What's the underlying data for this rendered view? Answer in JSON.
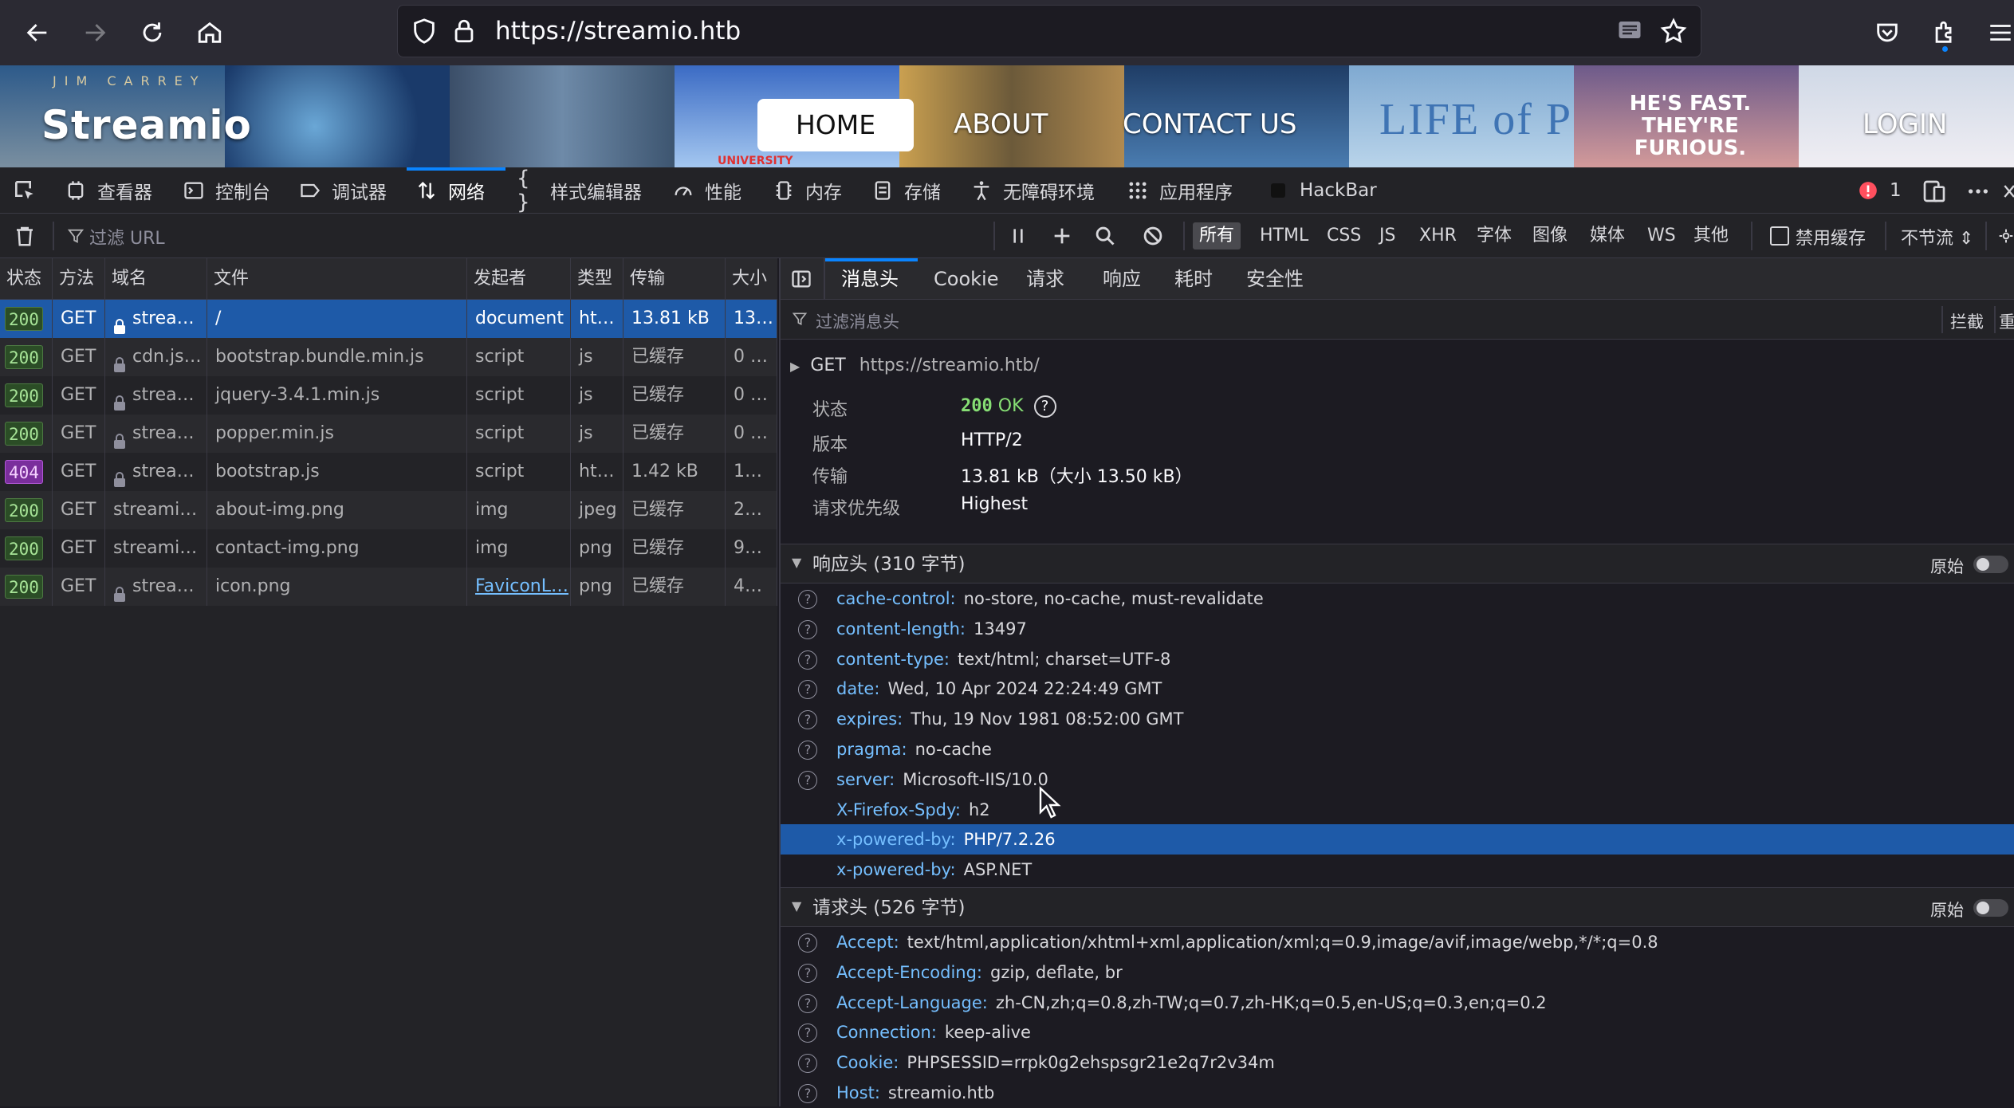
{
  "browser": {
    "url": "https://streamio.htb"
  },
  "site": {
    "logo": "Streamio",
    "nav": {
      "home": "HOME",
      "about": "ABOUT",
      "contact": "CONTACT US",
      "login": "LOGIN"
    },
    "banner_texts": {
      "jim_carrey": "JIM CARREY",
      "life_of_pi": "LIFE of PI",
      "fast_furious": "HE'S FAST. THEY'RE FURIOUS.",
      "university": "UNIVERSITY"
    }
  },
  "devtools": {
    "tabs": {
      "inspector": "查看器",
      "console": "控制台",
      "debugger": "调试器",
      "network": "网络",
      "style_editor": "样式编辑器",
      "performance": "性能",
      "memory": "内存",
      "storage": "存储",
      "accessibility": "无障碍环境",
      "application": "应用程序",
      "hackbar": "HackBar"
    },
    "error_count": "1",
    "filter_placeholder": "过滤 URL",
    "filter_types": [
      "所有",
      "HTML",
      "CSS",
      "JS",
      "XHR",
      "字体",
      "图像",
      "媒体",
      "WS",
      "其他"
    ],
    "disable_cache": "禁用缓存",
    "throttle": "不节流 ⇕",
    "columns": {
      "status": "状态",
      "method": "方法",
      "domain": "域名",
      "file": "文件",
      "initiator": "发起者",
      "type": "类型",
      "transferred": "传输",
      "size": "大小"
    },
    "requests": [
      {
        "status": "200",
        "method": "GET",
        "domain": "strea…",
        "file": "/",
        "initiator": "document",
        "type": "ht…",
        "transferred": "13.81 kB",
        "size": "13…"
      },
      {
        "status": "200",
        "method": "GET",
        "domain": "cdn.js…",
        "file": "bootstrap.bundle.min.js",
        "initiator": "script",
        "type": "js",
        "transferred": "已缓存",
        "size": "0 …"
      },
      {
        "status": "200",
        "method": "GET",
        "domain": "strea…",
        "file": "jquery-3.4.1.min.js",
        "initiator": "script",
        "type": "js",
        "transferred": "已缓存",
        "size": "0 …"
      },
      {
        "status": "200",
        "method": "GET",
        "domain": "strea…",
        "file": "popper.min.js",
        "initiator": "script",
        "type": "js",
        "transferred": "已缓存",
        "size": "0 …"
      },
      {
        "status": "404",
        "method": "GET",
        "domain": "strea…",
        "file": "bootstrap.js",
        "initiator": "script",
        "type": "ht…",
        "transferred": "1.42 kB",
        "size": "1…"
      },
      {
        "status": "200",
        "method": "GET",
        "domain": "streamio…",
        "file": "about-img.png",
        "initiator": "img",
        "type": "jpeg",
        "transferred": "已缓存",
        "size": "2…"
      },
      {
        "status": "200",
        "method": "GET",
        "domain": "streamio…",
        "file": "contact-img.png",
        "initiator": "img",
        "type": "png",
        "transferred": "已缓存",
        "size": "9…"
      },
      {
        "status": "200",
        "method": "GET",
        "domain": "strea…",
        "file": "icon.png",
        "initiator": "FaviconL…",
        "type": "png",
        "transferred": "已缓存",
        "size": "4…"
      }
    ],
    "details": {
      "tabs": [
        "消息头",
        "Cookie",
        "请求",
        "响应",
        "耗时",
        "安全性"
      ],
      "filter_placeholder": "过滤消息头",
      "block_label": "拦截",
      "resend_label": "重",
      "request_line": {
        "method": "GET",
        "url": "https://streamio.htb/"
      },
      "summary": [
        {
          "label": "状态",
          "value": "200 OK"
        },
        {
          "label": "版本",
          "value": "HTTP/2"
        },
        {
          "label": "传输",
          "value": "13.81 kB（大小 13.50 kB）"
        },
        {
          "label": "请求优先级",
          "value": "Highest"
        }
      ],
      "status_code": "200",
      "status_text": "OK",
      "response_headers_title": "响应头 (310 字节)",
      "raw_label": "原始",
      "response_headers": [
        {
          "name": "cache-control:",
          "value": "no-store, no-cache, must-revalidate"
        },
        {
          "name": "content-length:",
          "value": "13497"
        },
        {
          "name": "content-type:",
          "value": "text/html; charset=UTF-8"
        },
        {
          "name": "date:",
          "value": "Wed, 10 Apr 2024 22:24:49 GMT"
        },
        {
          "name": "expires:",
          "value": "Thu, 19 Nov 1981 08:52:00 GMT"
        },
        {
          "name": "pragma:",
          "value": "no-cache"
        },
        {
          "name": "server:",
          "value": "Microsoft-IIS/10.0"
        },
        {
          "name": "X-Firefox-Spdy:",
          "value": "h2"
        },
        {
          "name": "x-powered-by:",
          "value": "PHP/7.2.26"
        },
        {
          "name": "x-powered-by:",
          "value": "ASP.NET"
        }
      ],
      "request_headers_title": "请求头 (526 字节)",
      "request_headers": [
        {
          "name": "Accept:",
          "value": "text/html,application/xhtml+xml,application/xml;q=0.9,image/avif,image/webp,*/*;q=0.8"
        },
        {
          "name": "Accept-Encoding:",
          "value": "gzip, deflate, br"
        },
        {
          "name": "Accept-Language:",
          "value": "zh-CN,zh;q=0.8,zh-TW;q=0.7,zh-HK;q=0.5,en-US;q=0.3,en;q=0.2"
        },
        {
          "name": "Connection:",
          "value": "keep-alive"
        },
        {
          "name": "Cookie:",
          "value": "PHPSESSID=rrpk0g2ehspsgr21e2q7r2v34m"
        },
        {
          "name": "Host:",
          "value": "streamio.htb"
        }
      ]
    }
  }
}
